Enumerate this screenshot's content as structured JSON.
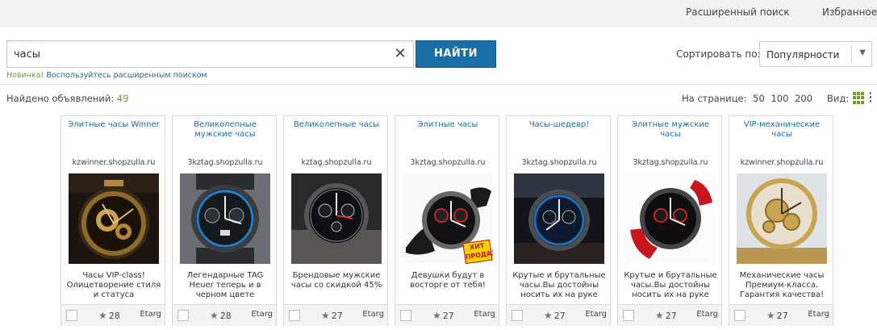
{
  "topbar": {
    "advanced_search": "Расширенный поиск",
    "favorites": "Избранное"
  },
  "search": {
    "value": "часы",
    "button_label": "НАЙТИ",
    "hint_new": "Новинка!",
    "hint_link": "Воспользуйтесь расширенным поиском"
  },
  "sort": {
    "label": "Сортировать по:",
    "value": "Популярности"
  },
  "results": {
    "found_label": "Найдено объявлений:",
    "found_count": "49",
    "per_page_label": "На странице:",
    "per_page_options": [
      "50",
      "100",
      "200"
    ],
    "view_label": "Вид:"
  },
  "cards": [
    {
      "title": "Элитные часы Winner",
      "domain": "kzwinner.shopzulla.ru",
      "desc": "Часы VIP-class! Олицетворение стиля и статуса",
      "rating": "28",
      "store": "Etarg"
    },
    {
      "title": "Великолепные мужские часы",
      "domain": "3kztag.shopzulla.ru",
      "desc": "Легендарные TAG Heuer теперь и в черном цвете",
      "rating": "28",
      "store": "Etarg"
    },
    {
      "title": "Великолепные часы",
      "domain": "kztag.shopzulla.ru",
      "desc": "Брендовые мужские часы со скидкой 45%",
      "rating": "27",
      "store": "Etarg"
    },
    {
      "title": "Элитные часы",
      "domain": "3kztag.shopzulla.ru",
      "desc": "Девушки будут в восторге от тебя!",
      "rating": "27",
      "store": "Etarg",
      "badge": "ХИТ ПРОДАЖ"
    },
    {
      "title": "Часы-шедевр!",
      "domain": "3kztag.shopzulla.ru",
      "desc": "Крутые и брутальные часы.Вы достойны носить их на руке",
      "rating": "27",
      "store": "Etarg"
    },
    {
      "title": "Элитные мужские часы",
      "domain": "3kztag.shopzulla.ru",
      "desc": "Крутые и брутальные часы.Вы достойны носить их на руке",
      "rating": "27",
      "store": "Etarg"
    },
    {
      "title": "VIP-механические часы",
      "domain": "kzwinner.shopzulla.ru",
      "desc": "Механические часы Премиум-класса. Гарантия качества!",
      "rating": "27",
      "store": "Etarg"
    }
  ]
}
